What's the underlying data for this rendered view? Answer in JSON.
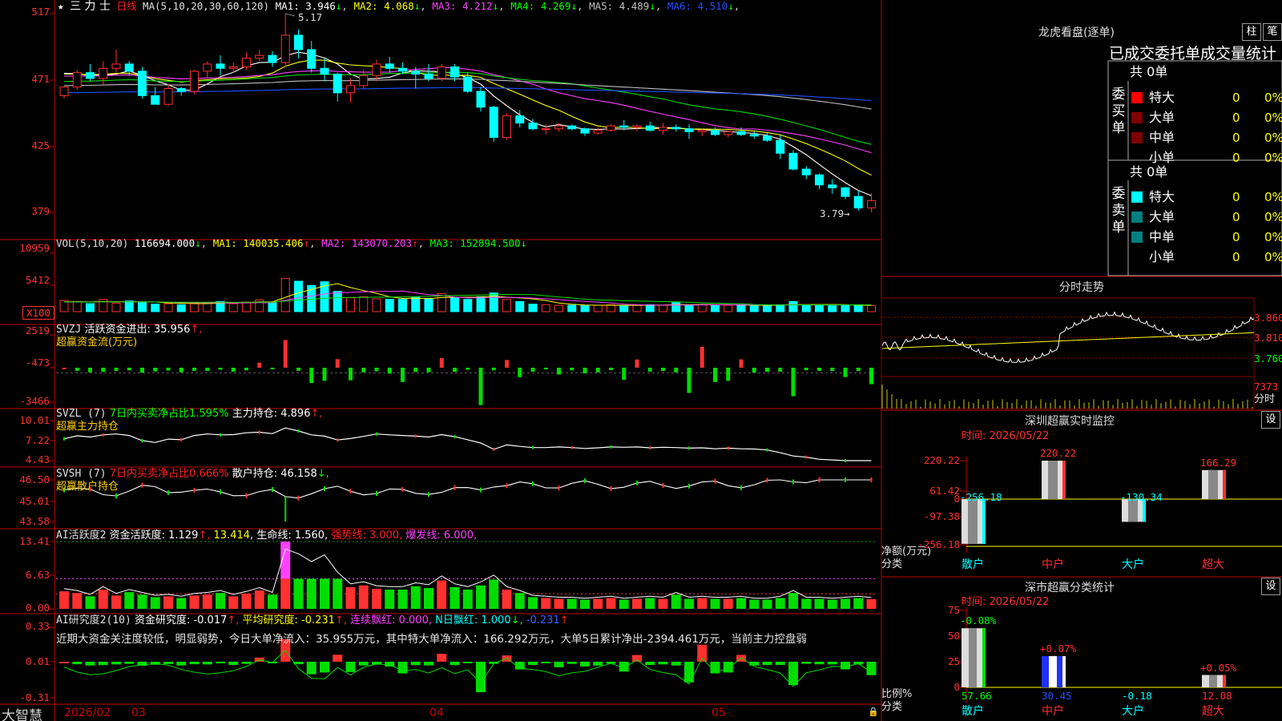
{
  "header": {
    "star": "★",
    "stock_name": "三 力 士",
    "period": "日线",
    "ma_spec": "MA(5,10,20,30,60,120)",
    "ma": [
      {
        "label": "MA1: 3.946",
        "arrow": "↓",
        "color": "#ffffff"
      },
      {
        "label": "MA2: 4.068",
        "arrow": "↓",
        "color": "#ffff00"
      },
      {
        "label": "MA3: 4.212",
        "arrow": "↓",
        "color": "#ff40ff"
      },
      {
        "label": "MA4: 4.269",
        "arrow": "↓",
        "color": "#00ff00"
      },
      {
        "label": "MA5: 4.489",
        "arrow": "↓",
        "color": "#c0c0c0"
      },
      {
        "label": "MA6: 4.510",
        "arrow": "↓",
        "color": "#2050ff"
      }
    ],
    "high_marker": "5.17",
    "low_marker": "3.79→"
  },
  "axes": {
    "price": [
      "517",
      "471",
      "425",
      "379"
    ],
    "vol": [
      "10959",
      "5412",
      "X100"
    ],
    "svzj": [
      "2519",
      "-473",
      "-3466"
    ],
    "svzl": [
      "10.01",
      "7.22",
      "4.43"
    ],
    "svsh": [
      "46.50",
      "45.01",
      "43.58"
    ],
    "ai1": [
      "13.41",
      "6.63",
      "0.00"
    ],
    "ai2": [
      "0.33",
      "0.01",
      "-0.31"
    ]
  },
  "vol_header": {
    "spec": "VOL(5,10,20)",
    "value": "116694.000",
    "value_arrow": "↓",
    "ma1": "MA1: 140035.406",
    "ma1_arrow": "↑",
    "ma2": "MA2: 143070.203",
    "ma2_arrow": "↑",
    "ma3": "MA3: 152894.500",
    "ma3_arrow": "↓"
  },
  "svzj_header": {
    "spec": "SVZJ",
    "line": "活跃资金进出: 35.956",
    "arrow": "↑,",
    "sub": "超赢资金流(万元)"
  },
  "svzl_header": {
    "spec": "SVZL (7)",
    "ratio": "7日内买卖净占比1.595%",
    "holding": "主力持仓: 4.896",
    "arrow": "↑,",
    "sub": "超赢主力持仓"
  },
  "svsh_header": {
    "spec": "SVSH (7)",
    "ratio": "7日内买卖净占比0.666%",
    "holding": "散户持仓: 46.158",
    "arrow": "↓,",
    "sub": "超赢散户持仓"
  },
  "ai1_header": {
    "spec": "AI活跃度2",
    "active": "资金活跃度: 1.129",
    "a1": "↑,",
    "val2": "13.414",
    "a2": ",",
    "life": "生命线: 1.560",
    "a3": ",",
    "strong": "强势线: 3.000",
    "a4": ",",
    "burst": "爆发线: 6.000",
    "a5": ","
  },
  "ai2_header": {
    "spec": "AI研究度2(10)",
    "research": "资金研究度: -0.017",
    "r_arrow": "↑,",
    "avg": "平均研究度: -0.231",
    "avg_arrow": "↑,",
    "streak": "连续飘红: 0.000,",
    "nday": "N日飘红: 1.000",
    "n_arrow": "↓,",
    "last": "-0.231",
    "last_arrow": "↑"
  },
  "commentary": "近期大资金关注度较低，明显弱势，今日大单净流入：35.955万元，其中特大单净流入：166.292万元，大单5日累计净出-2394.461万元，当前主力控盘弱",
  "footer": {
    "brand": "大智慧",
    "date_start": "2026/02",
    "months": [
      "03",
      "04",
      "05"
    ],
    "lock": "🔒"
  },
  "dragon_tiger": {
    "title": "龙虎看盘(逐单)",
    "btn_zhu": "柱",
    "btn_bi": "笔",
    "subtitle": "已成交委托单成交量统计",
    "buy_label": "委\n买\n单",
    "sell_label": "委\n卖\n单",
    "buy_total": "共 0单",
    "sell_total": "共 0单",
    "buy_rows": [
      {
        "name": "特大",
        "val": "0",
        "pct": "0%",
        "color": "#ff0000"
      },
      {
        "name": "大单",
        "val": "0",
        "pct": "0%",
        "color": "#800000"
      },
      {
        "name": "中单",
        "val": "0",
        "pct": "0%",
        "color": "#800000"
      },
      {
        "name": "小单",
        "val": "0",
        "pct": "0%",
        "color": ""
      }
    ],
    "sell_rows": [
      {
        "name": "特大",
        "val": "0",
        "pct": "0%",
        "color": "#00ffff"
      },
      {
        "name": "大单",
        "val": "0",
        "pct": "0%",
        "color": "#008080"
      },
      {
        "name": "中单",
        "val": "0",
        "pct": "0%",
        "color": "#008080"
      },
      {
        "name": "小单",
        "val": "0",
        "pct": "0%",
        "color": ""
      }
    ]
  },
  "intraday": {
    "title": "分时走势",
    "prices": [
      "3.860",
      "3.810",
      "3.760"
    ],
    "vol_value": "7373",
    "vol_unit": "分时"
  },
  "sz_monitor": {
    "title": "深圳超赢实时监控",
    "settings": "设",
    "time_label": "时间: 2026/05/22",
    "axis": [
      "220.22",
      "61.42",
      "0",
      "-97.38",
      "-256.18"
    ],
    "unit_line1": "净额(万元)",
    "unit_line2": "分类",
    "bars": [
      {
        "cat": "散户",
        "value": "-256.18"
      },
      {
        "cat": "中户",
        "value": "220.22"
      },
      {
        "cat": "大户",
        "value": "-130.34"
      },
      {
        "cat": "超大",
        "value": "166.29"
      }
    ]
  },
  "sz_class": {
    "title": "深市超赢分类统计",
    "settings": "设",
    "time_label": "时间: 2026/05/22",
    "axis": [
      "75",
      "50",
      "25",
      "0"
    ],
    "unit_line1": "比例%",
    "unit_line2": "分类",
    "bars": [
      {
        "cat": "散户",
        "value": "57.66",
        "change": "-0.08%"
      },
      {
        "cat": "中户",
        "value": "30.45",
        "change": "+0.07%"
      },
      {
        "cat": "大户",
        "value": "-0.18",
        "change": ""
      },
      {
        "cat": "超大",
        "value": "12.08",
        "change": "+0.05%"
      }
    ]
  },
  "chart_data": {
    "type": "candlestick",
    "ohlc": [
      [
        4.6,
        4.66,
        4.58,
        4.66
      ],
      [
        4.66,
        4.78,
        4.64,
        4.76
      ],
      [
        4.76,
        4.82,
        4.7,
        4.72
      ],
      [
        4.72,
        4.84,
        4.68,
        4.79
      ],
      [
        4.79,
        4.92,
        4.76,
        4.82
      ],
      [
        4.82,
        4.84,
        4.74,
        4.77
      ],
      [
        4.77,
        4.8,
        4.58,
        4.6
      ],
      [
        4.6,
        4.66,
        4.54,
        4.54
      ],
      [
        4.54,
        4.68,
        4.53,
        4.65
      ],
      [
        4.65,
        4.66,
        4.6,
        4.63
      ],
      [
        4.63,
        4.78,
        4.61,
        4.77
      ],
      [
        4.77,
        4.84,
        4.72,
        4.82
      ],
      [
        4.82,
        4.88,
        4.74,
        4.79
      ],
      [
        4.79,
        4.83,
        4.76,
        4.8
      ],
      [
        4.8,
        4.9,
        4.78,
        4.86
      ],
      [
        4.86,
        4.92,
        4.84,
        4.88
      ],
      [
        4.88,
        4.91,
        4.8,
        4.83
      ],
      [
        4.83,
        5.17,
        4.8,
        5.02
      ],
      [
        5.02,
        5.06,
        4.86,
        4.92
      ],
      [
        4.92,
        4.98,
        4.76,
        4.79
      ],
      [
        4.79,
        4.86,
        4.7,
        4.75
      ],
      [
        4.75,
        4.76,
        4.56,
        4.62
      ],
      [
        4.62,
        4.72,
        4.55,
        4.67
      ],
      [
        4.67,
        4.78,
        4.65,
        4.74
      ],
      [
        4.74,
        4.85,
        4.7,
        4.82
      ],
      [
        4.82,
        4.87,
        4.76,
        4.79
      ],
      [
        4.79,
        4.83,
        4.75,
        4.77
      ],
      [
        4.77,
        4.8,
        4.65,
        4.75
      ],
      [
        4.75,
        4.82,
        4.7,
        4.72
      ],
      [
        4.72,
        4.82,
        4.7,
        4.8
      ],
      [
        4.8,
        4.82,
        4.7,
        4.73
      ],
      [
        4.73,
        4.76,
        4.62,
        4.63
      ],
      [
        4.63,
        4.66,
        4.49,
        4.52
      ],
      [
        4.52,
        4.53,
        4.28,
        4.31
      ],
      [
        4.31,
        4.48,
        4.29,
        4.46
      ],
      [
        4.46,
        4.5,
        4.38,
        4.41
      ],
      [
        4.41,
        4.44,
        4.36,
        4.37
      ],
      [
        4.37,
        4.4,
        4.33,
        4.37
      ],
      [
        4.37,
        4.41,
        4.35,
        4.39
      ],
      [
        4.39,
        4.4,
        4.36,
        4.37
      ],
      [
        4.37,
        4.38,
        4.32,
        4.34
      ],
      [
        4.34,
        4.38,
        4.33,
        4.36
      ],
      [
        4.36,
        4.4,
        4.35,
        4.39
      ],
      [
        4.39,
        4.43,
        4.36,
        4.38
      ],
      [
        4.38,
        4.4,
        4.35,
        4.39
      ],
      [
        4.39,
        4.42,
        4.35,
        4.36
      ],
      [
        4.36,
        4.41,
        4.33,
        4.38
      ],
      [
        4.38,
        4.4,
        4.35,
        4.37
      ],
      [
        4.37,
        4.4,
        4.3,
        4.35
      ],
      [
        4.35,
        4.37,
        4.32,
        4.36
      ],
      [
        4.36,
        4.38,
        4.32,
        4.33
      ],
      [
        4.33,
        4.36,
        4.31,
        4.35
      ],
      [
        4.35,
        4.38,
        4.32,
        4.33
      ],
      [
        4.33,
        4.35,
        4.3,
        4.32
      ],
      [
        4.32,
        4.34,
        4.28,
        4.29
      ],
      [
        4.29,
        4.33,
        4.16,
        4.2
      ],
      [
        4.2,
        4.22,
        4.08,
        4.09
      ],
      [
        4.09,
        4.11,
        4.02,
        4.05
      ],
      [
        4.05,
        4.06,
        3.95,
        3.98
      ],
      [
        3.98,
        4.02,
        3.92,
        3.96
      ],
      [
        3.96,
        3.97,
        3.88,
        3.9
      ],
      [
        3.9,
        3.94,
        3.8,
        3.82
      ],
      [
        3.82,
        3.92,
        3.79,
        3.87
      ]
    ],
    "volume": [
      2100,
      1900,
      1500,
      2300,
      1600,
      2000,
      1700,
      1400,
      1500,
      1300,
      1600,
      1700,
      1900,
      1500,
      1800,
      2200,
      1700,
      6200,
      5700,
      4900,
      5600,
      3800,
      2600,
      2800,
      2400,
      2300,
      2300,
      2700,
      2500,
      3400,
      2600,
      2300,
      2800,
      3500,
      2300,
      1900,
      1400,
      1300,
      1200,
      1200,
      1100,
      1200,
      1300,
      1100,
      1200,
      1300,
      1200,
      1700,
      1200,
      1300,
      1200,
      1200,
      1300,
      1100,
      1100,
      1300,
      1900,
      1200,
      1200,
      1100,
      1200,
      1300,
      1166.94
    ],
    "svzj": [
      0,
      -280,
      -420,
      -380,
      -300,
      -240,
      -450,
      -340,
      -260,
      -420,
      -280,
      -300,
      -180,
      -360,
      -240,
      460,
      -120,
      2519,
      -280,
      -1400,
      -1200,
      780,
      -1150,
      -420,
      -320,
      -540,
      -1300,
      -380,
      -410,
      880,
      -380,
      -180,
      -3400,
      -240,
      700,
      -860,
      -360,
      -150,
      -620,
      -240,
      -520,
      -430,
      -220,
      -1100,
      750,
      -360,
      -300,
      -420,
      -2300,
      1900,
      -1300,
      -1200,
      760,
      -430,
      -370,
      -360,
      -2600,
      -230,
      -290,
      -300,
      -850,
      -310,
      -1500
    ]
  }
}
